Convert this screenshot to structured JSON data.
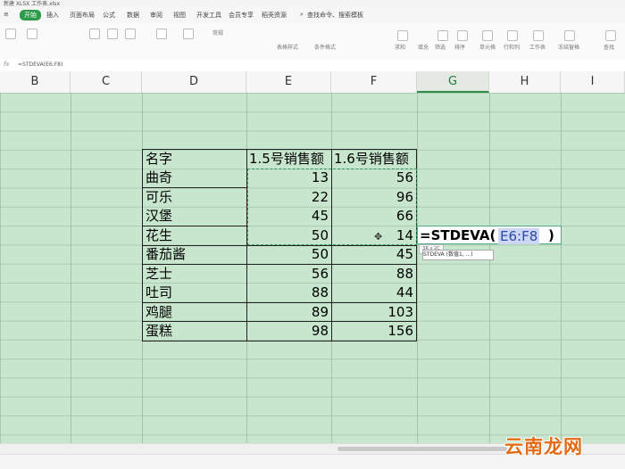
{
  "window": {
    "title": "新建 XLSX 工作表.xlsx"
  },
  "menu": {
    "items": [
      "开始",
      "插入",
      "页面布局",
      "公式",
      "数据",
      "审阅",
      "视图",
      "开发工具",
      "会员专享",
      "稻壳资源"
    ],
    "search": "查找命令、搜索模板"
  },
  "ribbon": {
    "labels": [
      "常规",
      "表格样式",
      "条件格式",
      "求和",
      "筛选",
      "排序",
      "填充",
      "单元格",
      "行和列",
      "工作表",
      "冻结窗格",
      "查找"
    ]
  },
  "formula_bar": {
    "fx": "fx",
    "content": "=STDEVA(E6:F8)"
  },
  "columns": [
    "B",
    "C",
    "D",
    "E",
    "F",
    "G",
    "H",
    "I"
  ],
  "table": {
    "headers": [
      "名字",
      "1.5号销售额",
      "1.6号销售额"
    ],
    "rows": [
      {
        "name": "曲奇",
        "e": "13",
        "f": "56"
      },
      {
        "name": "可乐",
        "e": "22",
        "f": "96"
      },
      {
        "name": "汉堡",
        "e": "45",
        "f": "66"
      },
      {
        "name": "花生",
        "e": "50",
        "f": "14"
      },
      {
        "name": "番茄酱",
        "e": "50",
        "f": "45"
      },
      {
        "name": "芝士",
        "e": "56",
        "f": "88"
      },
      {
        "name": "吐司",
        "e": "88",
        "f": "44"
      },
      {
        "name": "鸡腿",
        "e": "89",
        "f": "103"
      },
      {
        "name": "蛋糕",
        "e": "98",
        "f": "156"
      }
    ]
  },
  "edit": {
    "prefix": "=STDEVA(",
    "ref": "E6:F8",
    "suffix": ")",
    "tooltip": "STDEVA (数值1, ...)",
    "size": "3R x 2C"
  },
  "watermark": "云南龙网",
  "colors": {
    "grid_bg": "#c7e6cd",
    "accent": "#2e9b4a",
    "ref_highlight": "#cdd6f2"
  }
}
